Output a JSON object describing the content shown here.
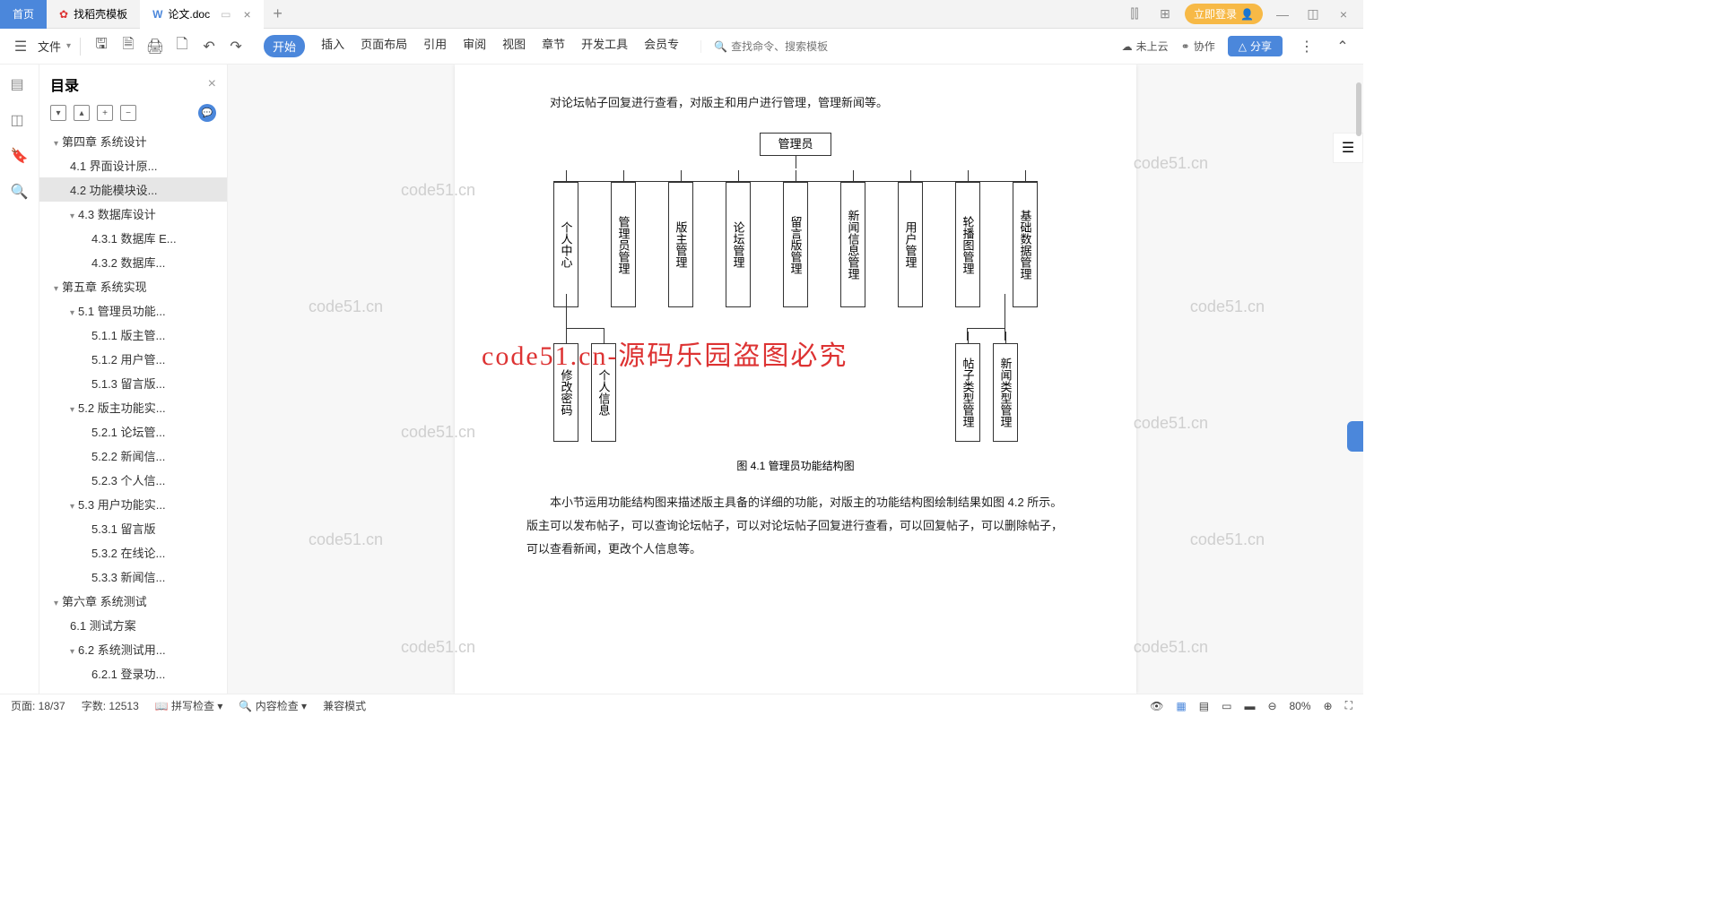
{
  "tabs": {
    "home": "首页",
    "template": "找稻壳模板",
    "doc": "论文.doc"
  },
  "login": "立即登录",
  "ribbon": {
    "file": "文件"
  },
  "menus": [
    "开始",
    "插入",
    "页面布局",
    "引用",
    "审阅",
    "视图",
    "章节",
    "开发工具",
    "会员专"
  ],
  "searchPlaceholder": "查找命令、搜索模板",
  "rtools": {
    "cloud": "未上云",
    "collab": "协作",
    "share": "分享"
  },
  "sidepanel": {
    "title": "目录"
  },
  "toc": [
    {
      "t": "第四章 系统设计",
      "l": 1,
      "c": 1
    },
    {
      "t": "4.1 界面设计原...",
      "l": 2
    },
    {
      "t": "4.2 功能模块设...",
      "l": 2,
      "sel": 1
    },
    {
      "t": "4.3 数据库设计",
      "l": 2,
      "c": 1
    },
    {
      "t": "4.3.1 数据库 E...",
      "l": 3
    },
    {
      "t": "4.3.2 数据库...",
      "l": 3
    },
    {
      "t": "第五章 系统实现",
      "l": 1,
      "c": 1
    },
    {
      "t": "5.1 管理员功能...",
      "l": 2,
      "c": 1
    },
    {
      "t": "5.1.1 版主管...",
      "l": 3
    },
    {
      "t": "5.1.2 用户管...",
      "l": 3
    },
    {
      "t": "5.1.3 留言版...",
      "l": 3
    },
    {
      "t": "5.2 版主功能实...",
      "l": 2,
      "c": 1
    },
    {
      "t": "5.2.1 论坛管...",
      "l": 3
    },
    {
      "t": "5.2.2 新闻信...",
      "l": 3
    },
    {
      "t": "5.2.3 个人信...",
      "l": 3
    },
    {
      "t": "5.3 用户功能实...",
      "l": 2,
      "c": 1
    },
    {
      "t": "5.3.1 留言版",
      "l": 3
    },
    {
      "t": "5.3.2 在线论...",
      "l": 3
    },
    {
      "t": "5.3.3 新闻信...",
      "l": 3
    },
    {
      "t": "第六章 系统测试",
      "l": 1,
      "c": 1
    },
    {
      "t": "6.1 测试方案",
      "l": 2
    },
    {
      "t": "6.2 系统测试用...",
      "l": 2,
      "c": 1
    },
    {
      "t": "6.2.1 登录功...",
      "l": 3
    }
  ],
  "doc": {
    "p1": "对论坛帖子回复进行查看，对版主和用户进行管理，管理新闻等。",
    "root": "管理员",
    "boxes": [
      "个人中心",
      "管理员管理",
      "版主管理",
      "论坛管理",
      "留言版管理",
      "新闻信息管理",
      "用户管理",
      "轮播图管理",
      "基础数据管理"
    ],
    "sub1": [
      "修改密码",
      "个人信息"
    ],
    "sub2": [
      "帖子类型管理",
      "新闻类型管理"
    ],
    "caption": "图 4.1 管理员功能结构图",
    "p2": "本小节运用功能结构图来描述版主具备的详细的功能，对版主的功能结构图绘制结果如图 4.2 所示。版主可以发布帖子，可以查询论坛帖子，可以对论坛帖子回复进行查看，可以回复帖子，可以删除帖子，可以查看新闻，更改个人信息等。"
  },
  "watermark": {
    "small": "code51.cn",
    "big": "code51.cn-源码乐园盗图必究"
  },
  "status": {
    "page": "页面: 18/37",
    "words": "字数: 12513",
    "spell": "拼写检查",
    "content": "内容检查",
    "compat": "兼容模式",
    "zoom": "80%"
  }
}
